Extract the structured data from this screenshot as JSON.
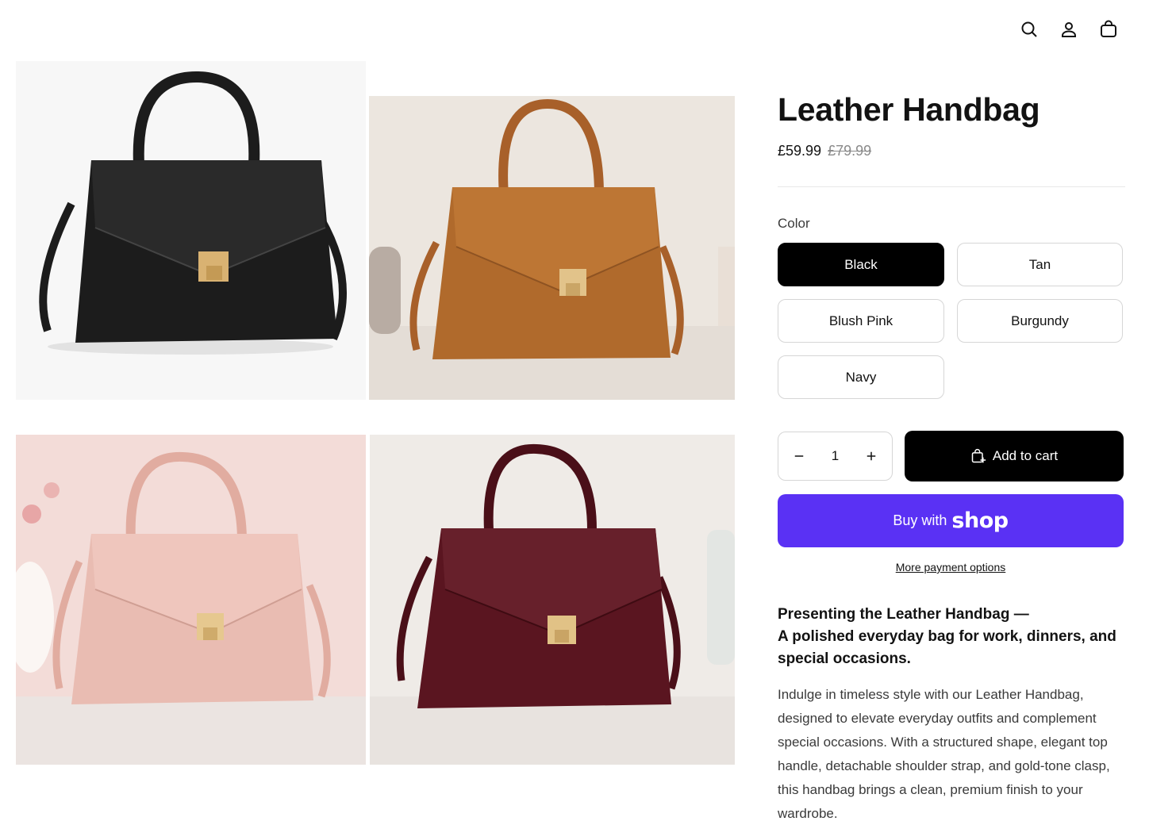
{
  "header": {
    "icons": [
      "search-icon",
      "account-icon",
      "cart-icon"
    ]
  },
  "gallery": {
    "images": [
      {
        "color": "Black",
        "hex": "#1c1c1c"
      },
      {
        "color": "Tan",
        "hex": "#b06a2c"
      },
      {
        "color": "Blush Pink",
        "hex": "#e9bcb2"
      },
      {
        "color": "Burgundy",
        "hex": "#5a1520"
      }
    ]
  },
  "product": {
    "title": "Leather Handbag",
    "price": "£59.99",
    "compare_price": "£79.99",
    "color_label": "Color",
    "colors": [
      "Black",
      "Tan",
      "Blush Pink",
      "Burgundy",
      "Navy"
    ],
    "selected_color": "Black",
    "quantity": "1",
    "add_to_cart": "Add to cart",
    "buy_with": "Buy with",
    "shop_word": "shop",
    "more_payment": "More payment options",
    "description_heading_1": "Presenting the Leather Handbag —",
    "description_heading_2": "A polished everyday bag for work, dinners, and special occasions.",
    "description_body": "Indulge in timeless style with our Leather Handbag, designed to elevate everyday outfits and complement special occasions. With a structured shape, elegant top handle, detachable shoulder strap, and gold-tone clasp, this handbag brings a clean, premium finish to your wardrobe."
  },
  "colors": {
    "primary_button": "#000000",
    "shop_pay": "#5a31f4",
    "border": "#d6d6d6"
  }
}
